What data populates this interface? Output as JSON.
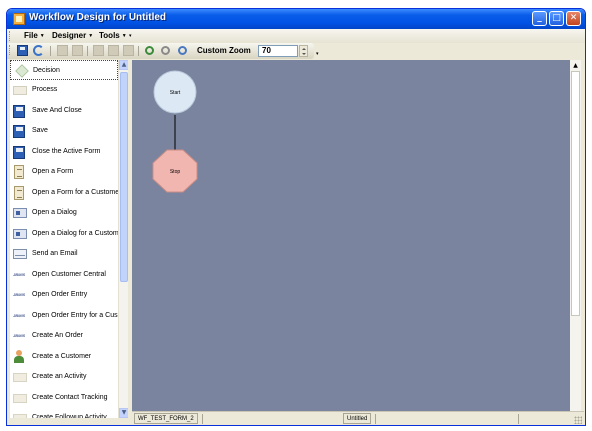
{
  "window": {
    "title": "Workflow Design for Untitled",
    "title_color": "#ffffff",
    "titlebar_color": "#0052e6"
  },
  "menu": {
    "items": [
      {
        "label": "File"
      },
      {
        "label": "Designer"
      },
      {
        "label": "Tools"
      }
    ]
  },
  "toolbar": {
    "zoom_label": "Custom Zoom",
    "zoom_value": "70",
    "icons": [
      "save-icon",
      "refresh-icon",
      "edit-icon",
      "copy-icon",
      "print-icon",
      "undo-icon",
      "redo-icon",
      "zoom-in-icon",
      "zoom-out-icon",
      "zoom-icon"
    ]
  },
  "palette": {
    "items": [
      {
        "label": "Decision",
        "icon": "decision-icon"
      },
      {
        "label": "Process",
        "icon": "process-icon"
      },
      {
        "label": "Save And Close",
        "icon": "floppy-icon"
      },
      {
        "label": "Save",
        "icon": "floppy-icon"
      },
      {
        "label": "Close the Active Form",
        "icon": "floppy-icon"
      },
      {
        "label": "Open a Form",
        "icon": "form-icon"
      },
      {
        "label": "Open a Form for a Custome",
        "icon": "form-icon"
      },
      {
        "label": "Open a Dialog",
        "icon": "dialog-icon"
      },
      {
        "label": "Open a Dialog for a Custom",
        "icon": "dialog-icon"
      },
      {
        "label": "Send an Email",
        "icon": "email-icon"
      },
      {
        "label": "Open Customer Central",
        "icon": "jbm-icon"
      },
      {
        "label": "Open Order Entry",
        "icon": "jbm-icon"
      },
      {
        "label": "Open Order Entry for a Cus",
        "icon": "jbm-icon"
      },
      {
        "label": "Create An Order",
        "icon": "jbm-icon"
      },
      {
        "label": "Create a Customer",
        "icon": "person-icon"
      },
      {
        "label": "Create an Activity",
        "icon": "blank-icon"
      },
      {
        "label": "Create Contact Tracking",
        "icon": "blank-icon"
      },
      {
        "label": "Create Followup Activity",
        "icon": "blank-icon"
      }
    ],
    "jbm_icon_text": "JBMIS"
  },
  "diagram": {
    "canvas_color": "#7a849e",
    "start": {
      "label": "Start",
      "color": "#dce8f4"
    },
    "stop": {
      "label": "Stop",
      "color": "#f2b6b0"
    }
  },
  "status": {
    "form_name": "WF_TEST_FORM_2",
    "document_name": "Untitled"
  }
}
